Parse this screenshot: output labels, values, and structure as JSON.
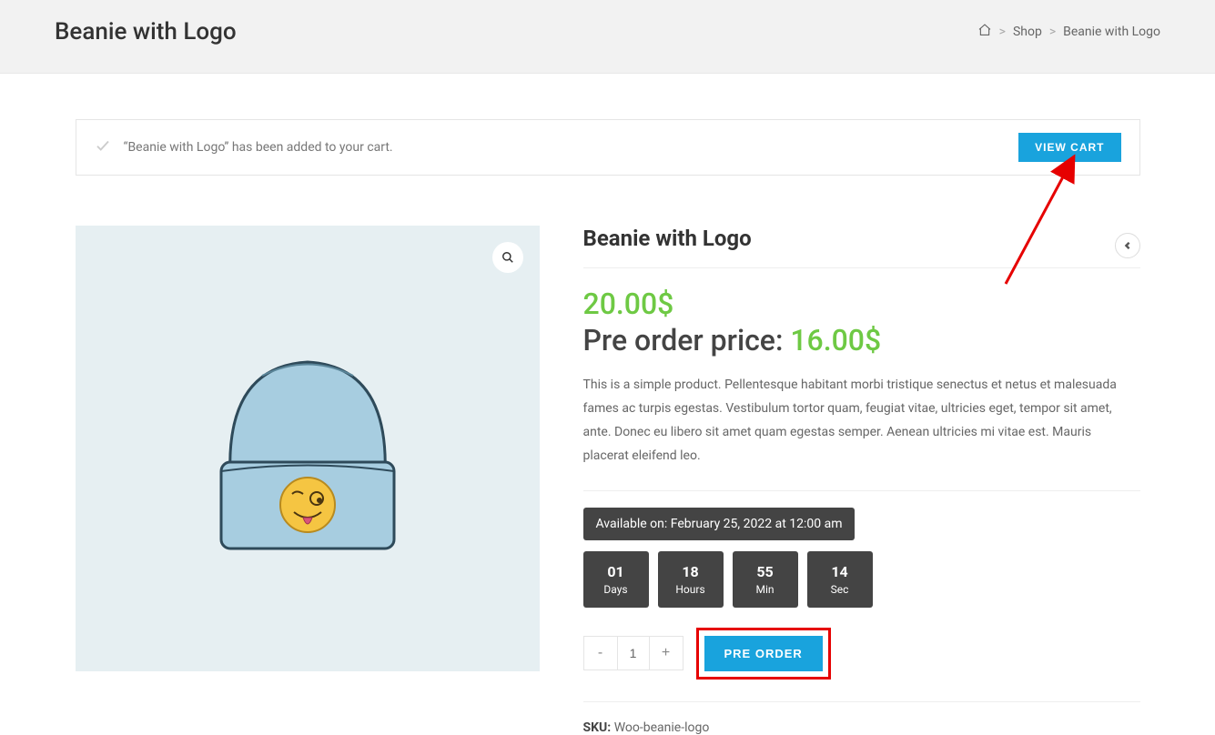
{
  "header": {
    "title": "Beanie with Logo",
    "breadcrumb": {
      "shop": "Shop",
      "current": "Beanie with Logo"
    }
  },
  "notice": {
    "message": "“Beanie with Logo” has been added to your cart.",
    "viewCart": "VIEW CART"
  },
  "product": {
    "name": "Beanie with Logo",
    "price": "20.00$",
    "preorderLabel": "Pre order price: ",
    "preorderPrice": "16.00$",
    "description": "This is a simple product. Pellentesque habitant morbi tristique senectus et netus et malesuada fames ac turpis egestas. Vestibulum tortor quam, feugiat vitae, ultricies eget, tempor sit amet, ante. Donec eu libero sit amet quam egestas semper. Aenean ultricies mi vitae est. Mauris placerat eleifend leo.",
    "availableText": "Available on: February 25, 2022 at 12:00 am",
    "countdown": {
      "days": {
        "val": "01",
        "lbl": "Days"
      },
      "hours": {
        "val": "18",
        "lbl": "Hours"
      },
      "min": {
        "val": "55",
        "lbl": "Min"
      },
      "sec": {
        "val": "14",
        "lbl": "Sec"
      }
    },
    "qty": "1",
    "preorderBtn": "PRE ORDER",
    "skuLabel": "SKU: ",
    "sku": "Woo-beanie-logo"
  }
}
